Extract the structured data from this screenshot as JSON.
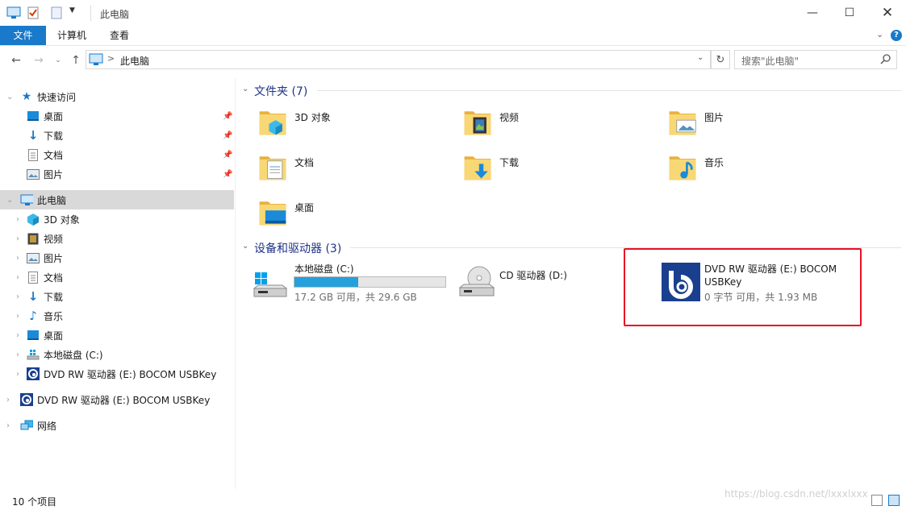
{
  "window": {
    "title": "此电脑"
  },
  "ribbon": {
    "tabs": [
      "文件",
      "计算机",
      "查看"
    ]
  },
  "address": {
    "crumb_sep": ">",
    "location": "此电脑"
  },
  "search": {
    "placeholder": "搜索\"此电脑\""
  },
  "nav": {
    "quick_access": "快速访问",
    "quick_items": [
      "桌面",
      "下载",
      "文档",
      "图片"
    ],
    "this_pc": "此电脑",
    "pc_items": [
      "3D 对象",
      "视频",
      "图片",
      "文档",
      "下载",
      "音乐",
      "桌面",
      "本地磁盘 (C:)",
      "DVD RW 驱动器 (E:) BOCOM USBKey"
    ],
    "dvd_root": "DVD RW 驱动器 (E:) BOCOM USBKey",
    "network": "网络"
  },
  "folders": {
    "header": "文件夹 (7)",
    "items": [
      "3D 对象",
      "视频",
      "图片",
      "文档",
      "下载",
      "音乐",
      "桌面"
    ]
  },
  "drives": {
    "header": "设备和驱动器 (3)",
    "items": [
      {
        "name": "本地磁盘 (C:)",
        "detail": "17.2 GB 可用，共 29.6 GB",
        "used_fraction": 0.42
      },
      {
        "name": "CD 驱动器 (D:)"
      },
      {
        "name_line1": "DVD RW 驱动器 (E:) BOCOM",
        "name_line2": "USBKey",
        "detail": "0 字节 可用，共 1.93 MB"
      }
    ]
  },
  "status": {
    "count": "10 个项目",
    "watermark": "https://blog.csdn.net/lxxxlxxx"
  },
  "colors": {
    "accent": "#1979ca",
    "drive_fill": "#26a0da",
    "highlight_box": "#e81123",
    "folder": "#f4c65a",
    "group_title": "#1e3287"
  }
}
